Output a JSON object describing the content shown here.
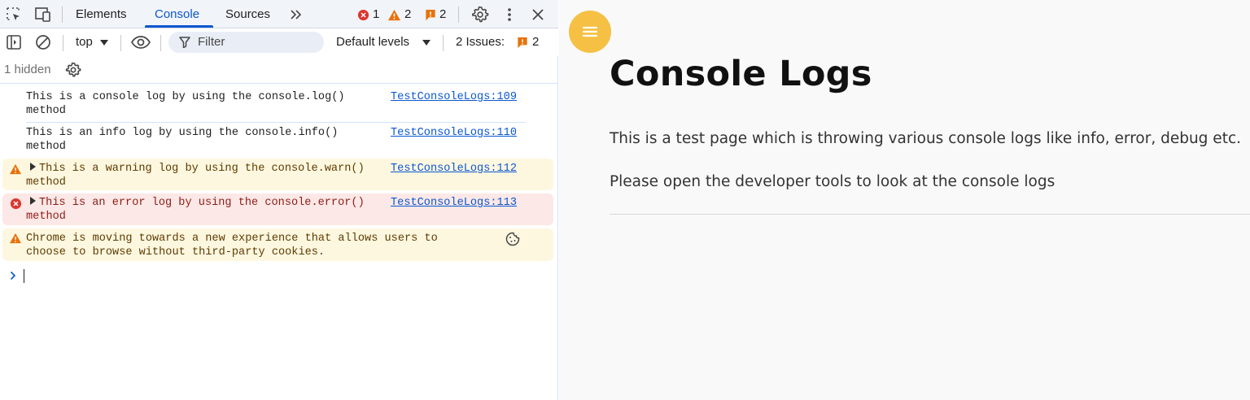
{
  "devtools": {
    "tabs": [
      "Elements",
      "Console",
      "Sources"
    ],
    "active_tab": "Console",
    "counts": {
      "errors": "1",
      "warnings": "2",
      "issues": "2"
    },
    "toolbar": {
      "context": "top",
      "filter_placeholder": "Filter",
      "levels": "Default levels",
      "issues_label": "2 Issues:",
      "issues_count": "2"
    },
    "hidden_label": "1 hidden",
    "logs": [
      {
        "level": "log",
        "line1": "This is a console log by using the console.log()",
        "line2": "method",
        "source": "TestConsoleLogs:109"
      },
      {
        "level": "info",
        "line1": "This is an info log by using the console.info()",
        "line2": "method",
        "source": "TestConsoleLogs:110"
      },
      {
        "level": "warn",
        "line1": "This is a warning log by using the console.warn()",
        "line2": "method",
        "source": "TestConsoleLogs:112"
      },
      {
        "level": "error",
        "line1": "This is an error log by using the console.error()",
        "line2": "method",
        "source": "TestConsoleLogs:113"
      },
      {
        "level": "warn",
        "line1": "Chrome is moving towards a new experience that allows users to",
        "line2": "choose to browse without third-party cookies."
      }
    ]
  },
  "page": {
    "title": "Console Logs",
    "paragraph1": "This is a test page which is throwing various console logs like info, error, debug etc.",
    "paragraph2": "Please open the developer tools to look at the console logs"
  },
  "colors": {
    "accent": "#0b57d0",
    "fab": "#f5c044",
    "warn_bg": "#fef7e0",
    "error_bg": "#fce8e6"
  }
}
